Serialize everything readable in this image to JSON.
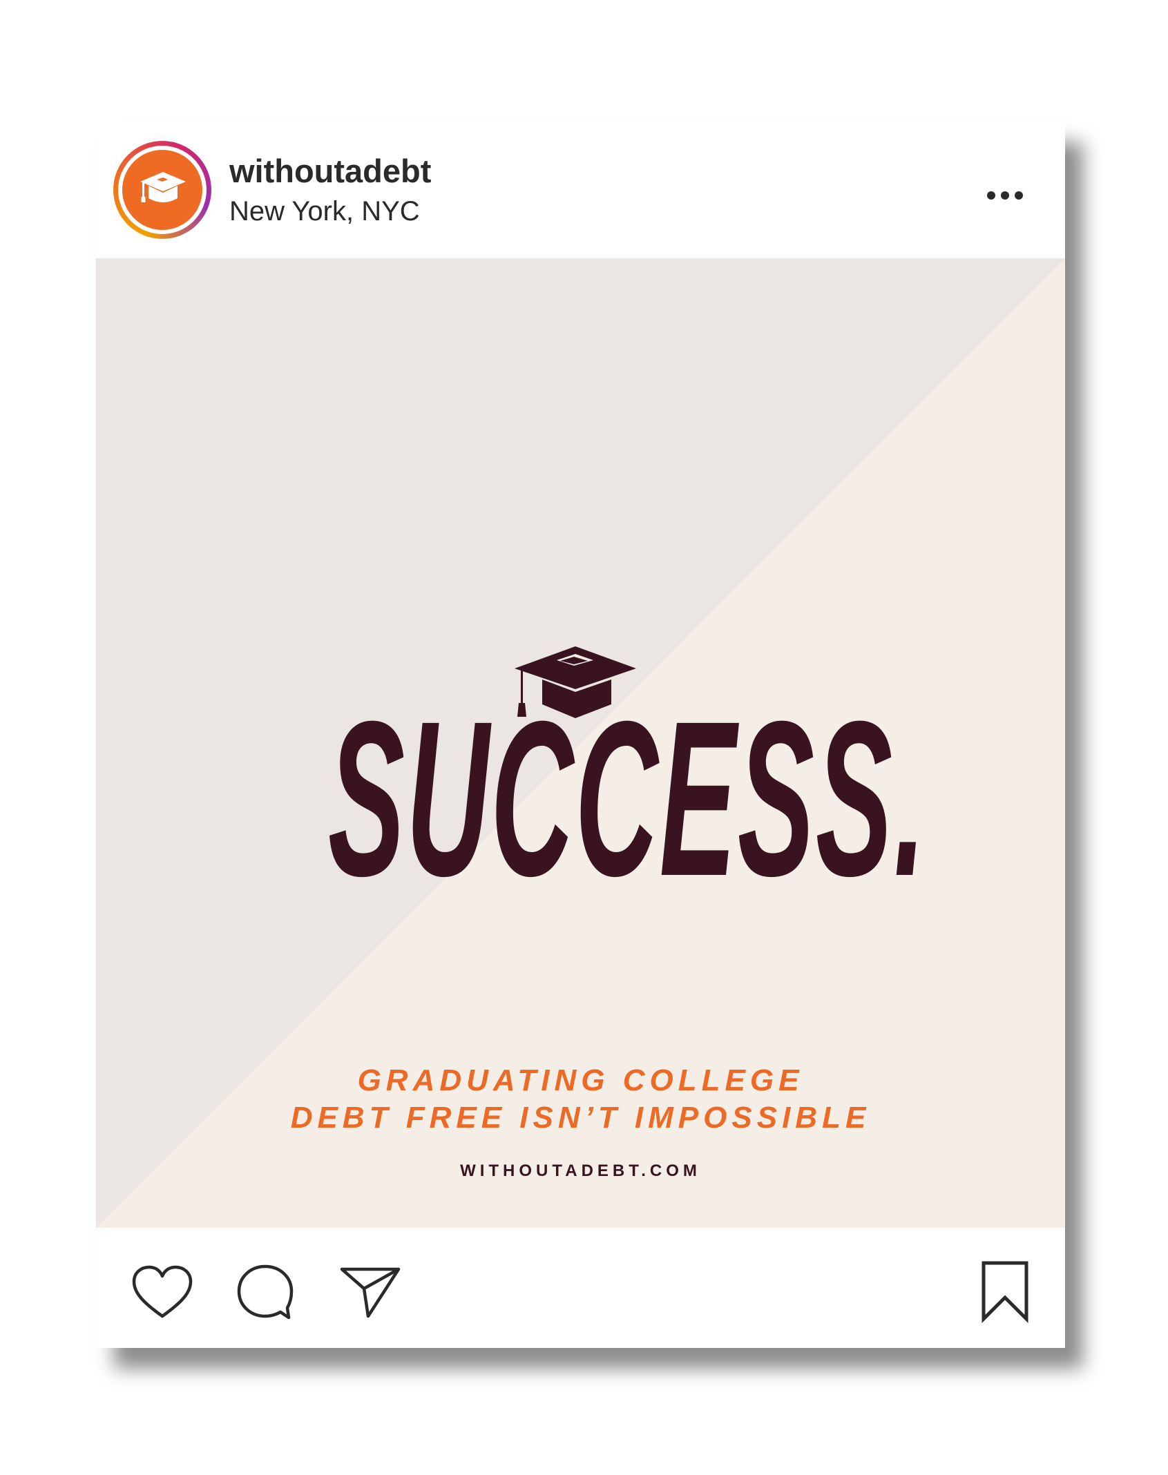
{
  "post": {
    "username": "withoutadebt",
    "location": "New York, NYC",
    "more_icon": "more-options-icon"
  },
  "image": {
    "headline": "SUCCESS.",
    "tagline_line1": "GRADUATING COLLEGE",
    "tagline_line2": "DEBT FREE ISN’T IMPOSSIBLE",
    "website": "WITHOUTADEBT.COM",
    "colors": {
      "background_light": "#ebe6e2",
      "background_cream": "#f4eee6",
      "headline": "#3a1320",
      "accent": "#ec6a25"
    }
  },
  "actions": {
    "like_icon": "heart-icon",
    "comment_icon": "comment-icon",
    "share_icon": "send-icon",
    "save_icon": "bookmark-icon"
  },
  "avatar": {
    "icon": "graduation-cap-icon",
    "color": "#ef6a23"
  }
}
